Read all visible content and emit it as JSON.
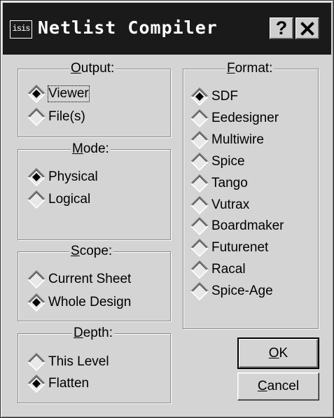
{
  "window": {
    "app_icon_text": "isis",
    "title": "Netlist Compiler"
  },
  "titlebar_buttons": {
    "help": "?",
    "close": "close-icon"
  },
  "output": {
    "title": "Output:",
    "options": [
      "Viewer",
      "File(s)"
    ],
    "selected": "Viewer"
  },
  "mode": {
    "title": "Mode:",
    "options": [
      "Physical",
      "Logical"
    ],
    "selected": "Physical"
  },
  "scope": {
    "title": "Scope:",
    "options": [
      "Current Sheet",
      "Whole Design"
    ],
    "selected": "Whole Design"
  },
  "depth": {
    "title": "Depth:",
    "options": [
      "This Level",
      "Flatten"
    ],
    "selected": "Flatten"
  },
  "format": {
    "title": "Format:",
    "options": [
      "SDF",
      "Eedesigner",
      "Multiwire",
      "Spice",
      "Tango",
      "Vutrax",
      "Boardmaker",
      "Futurenet",
      "Racal",
      "Spice-Age"
    ],
    "selected": "SDF"
  },
  "buttons": {
    "ok": "OK",
    "cancel": "Cancel"
  }
}
